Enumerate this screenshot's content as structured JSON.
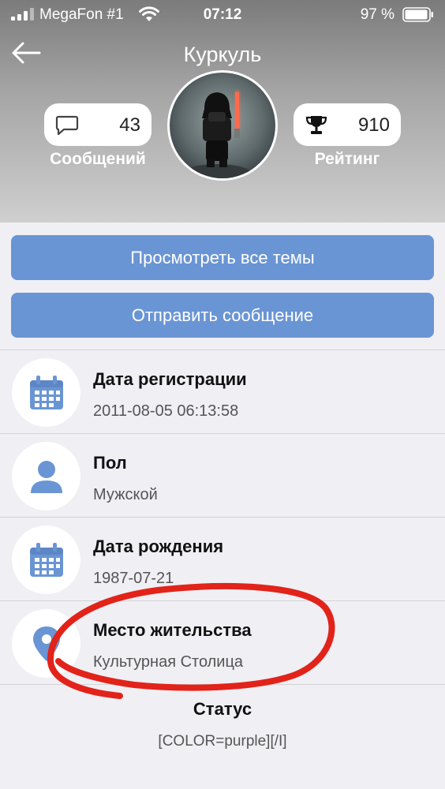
{
  "status_bar": {
    "carrier": "MegaFon #1",
    "time": "07:12",
    "battery": "97 %"
  },
  "header": {
    "title": "Куркуль",
    "messages_count": "43",
    "messages_label": "Сообщений",
    "rating_value": "910",
    "rating_label": "Рейтинг"
  },
  "buttons": {
    "view_topics": "Просмотреть все темы",
    "send_message": "Отправить сообщение"
  },
  "info": [
    {
      "title": "Дата регистрации",
      "value": "2011-08-05 06:13:58",
      "icon": "calendar-icon"
    },
    {
      "title": "Пол",
      "value": "Мужской",
      "icon": "user-icon"
    },
    {
      "title": "Дата рождения",
      "value": "1987-07-21",
      "icon": "calendar-icon"
    },
    {
      "title": "Место жительства",
      "value": "Культурная Столица",
      "icon": "location-pin-icon"
    }
  ],
  "status": {
    "title": "Статус",
    "value": "[COLOR=purple][/I]"
  },
  "colors": {
    "accent": "#6a95d4",
    "annotation": "#e2231a"
  }
}
